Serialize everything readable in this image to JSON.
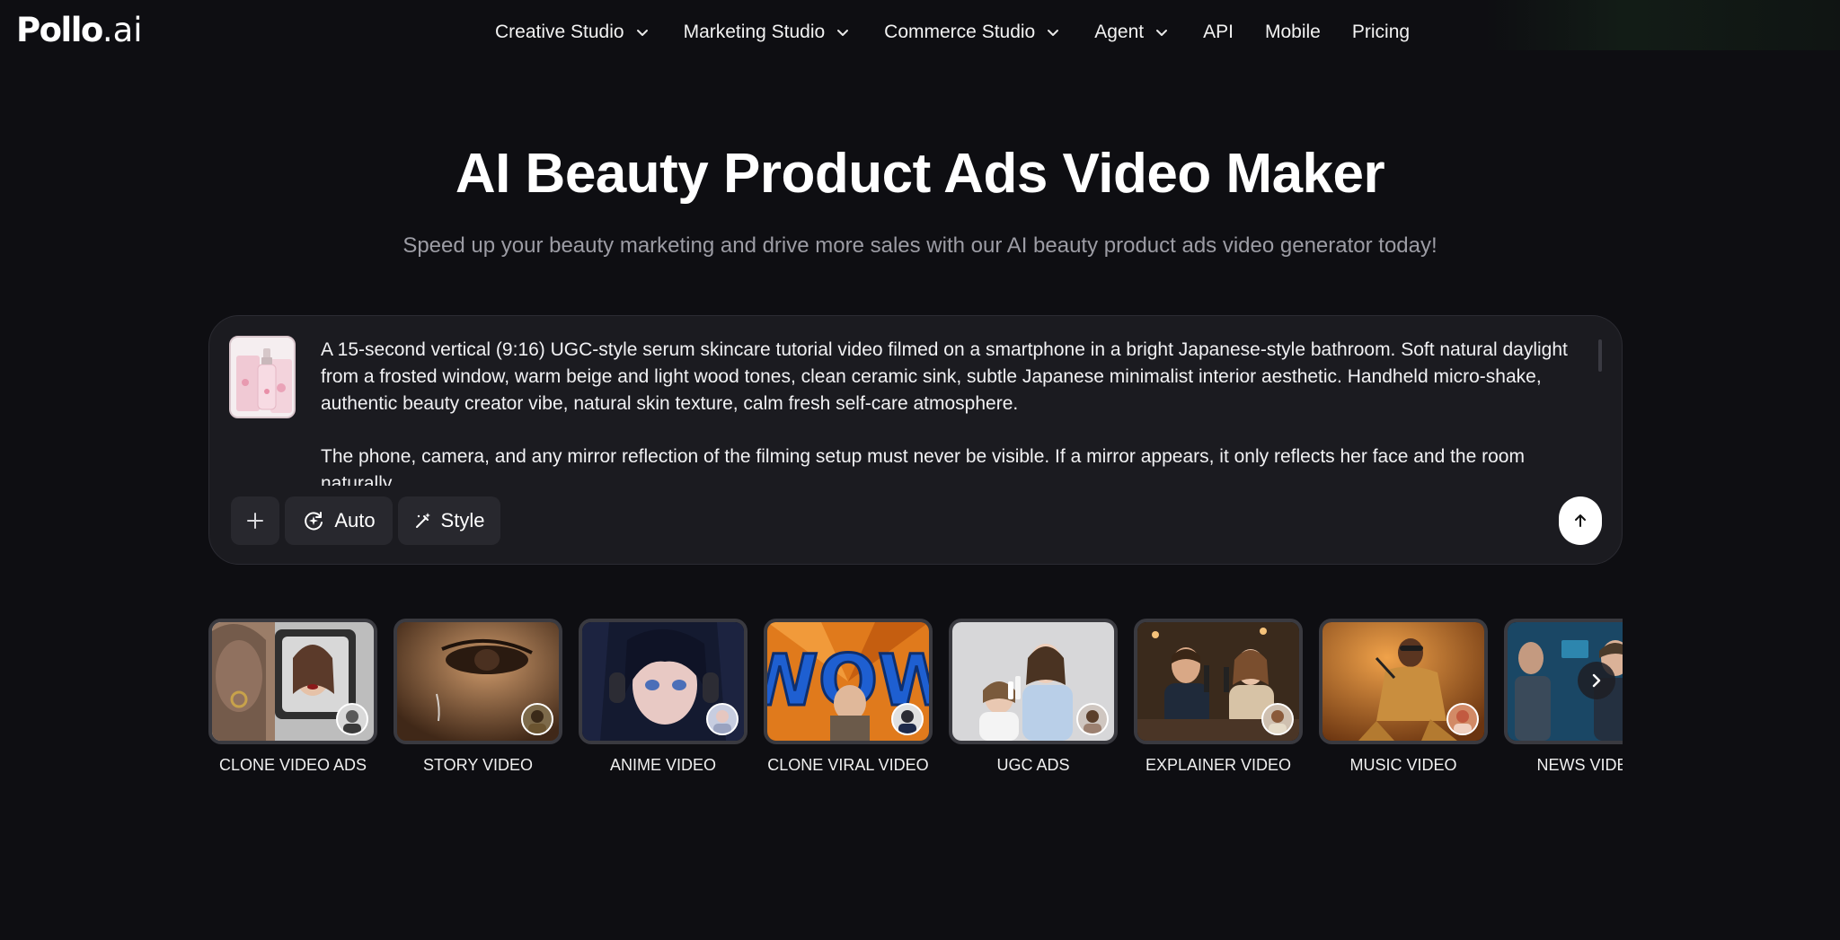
{
  "logo": {
    "brand": "Pollo",
    "suffix": ".ai"
  },
  "nav": {
    "items": [
      {
        "label": "Creative Studio",
        "has_dropdown": true
      },
      {
        "label": "Marketing Studio",
        "has_dropdown": true
      },
      {
        "label": "Commerce Studio",
        "has_dropdown": true
      },
      {
        "label": "Agent",
        "has_dropdown": true
      },
      {
        "label": "API",
        "has_dropdown": false
      },
      {
        "label": "Mobile",
        "has_dropdown": false
      },
      {
        "label": "Pricing",
        "has_dropdown": false
      }
    ]
  },
  "hero": {
    "title": "AI Beauty Product Ads Video Maker",
    "subtitle": "Speed up your beauty marketing and drive more sales with our AI beauty product ads video generator today!"
  },
  "prompt": {
    "paragraph1": "A 15-second vertical (9:16) UGC-style serum skincare tutorial video filmed on a smartphone in a bright Japanese-style bathroom. Soft natural daylight from a frosted window, warm beige and light wood tones, clean ceramic sink, subtle Japanese minimalist interior aesthetic. Handheld micro-shake, authentic beauty creator vibe, natural skin texture, calm fresh self-care atmosphere.",
    "paragraph2": "The phone, camera, and any mirror reflection of the filming setup must never be visible. If a mirror appears, it only reflects her face and the room naturally.",
    "auto_label": "Auto",
    "style_label": "Style"
  },
  "templates": [
    {
      "label": "CLONE VIDEO ADS"
    },
    {
      "label": "STORY VIDEO"
    },
    {
      "label": "ANIME VIDEO"
    },
    {
      "label": "CLONE VIRAL VIDEO"
    },
    {
      "label": "UGC ADS"
    },
    {
      "label": "EXPLAINER VIDEO"
    },
    {
      "label": "MUSIC VIDEO"
    },
    {
      "label": "NEWS VIDEO"
    }
  ],
  "icons": {
    "nav_dropdown": "chevron-down-icon",
    "add": "plus-icon",
    "auto": "auto-mode-icon",
    "style": "magic-wand-icon",
    "send": "arrow-up-icon",
    "carousel_next": "chevron-right-icon"
  },
  "colors": {
    "background": "#0e0e12",
    "card": "#1b1b20",
    "subtitle": "#9c9ca4"
  }
}
